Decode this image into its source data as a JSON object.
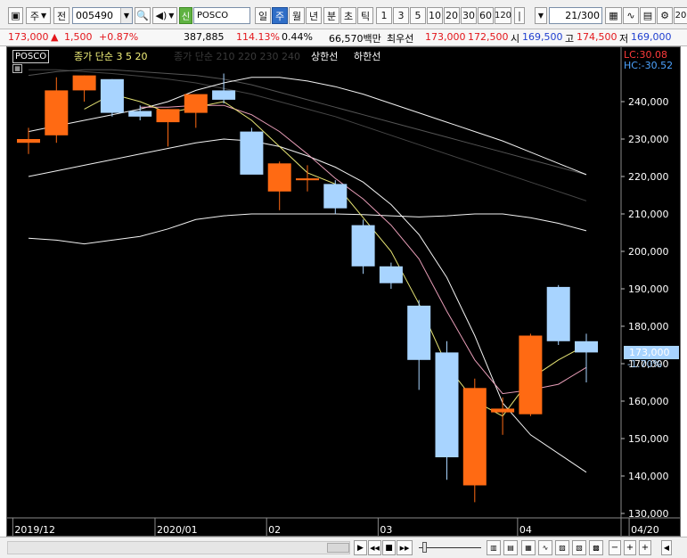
{
  "toolbar": {
    "market_type": "주",
    "market_sub": "전",
    "code": "005490",
    "badge": "신",
    "name": "POSCO",
    "period_day": "일",
    "period_week": "주",
    "period_month": "월",
    "period_year": "년",
    "period_min": "분",
    "period_tick": "초",
    "period_tick2": "틱",
    "intervals": [
      "1",
      "3",
      "5",
      "10",
      "20",
      "30",
      "60",
      "120"
    ],
    "count": "21",
    "total": "/300",
    "edge_label": "20"
  },
  "quote": {
    "price": "173,000",
    "change": "1,500",
    "change_pct": "+0.87%",
    "volume": "387,885",
    "volume_ratio": "114.13%",
    "turnover": "0.44%",
    "amount": "66,570백만",
    "best_ask_label": "최우선",
    "best_ask": "173,000",
    "best_bid": "172,500",
    "open_label": "시",
    "open": "169,500",
    "high_label": "고",
    "high": "174,500",
    "low_label": "저",
    "low": "169,000"
  },
  "legend": {
    "name": "POSCO",
    "close_ma": "종가 단순 3  5  20",
    "ma_long": "종가 단순 210 220 230 240",
    "upper_limit": "상한선",
    "lower_limit": "하한선",
    "lc": "LC:30.08",
    "hc": "HC:-30.52",
    "current_price": "173,000",
    "current_change": "-1.70%"
  },
  "chart_data": {
    "type": "candlestick",
    "ylim": [
      128000,
      250000
    ],
    "yticks": [
      130000,
      140000,
      150000,
      160000,
      170000,
      180000,
      190000,
      200000,
      210000,
      220000,
      230000,
      240000
    ],
    "ytick_labels": [
      "130,000",
      "140,000",
      "150,000",
      "160,000",
      "170,000",
      "180,000",
      "190,000",
      "200,000",
      "210,000",
      "220,000",
      "230,000",
      "240,000"
    ],
    "xlabels": [
      {
        "label": "2019/12",
        "index": -0.5
      },
      {
        "label": "2020/01",
        "index": 4.6
      },
      {
        "label": "02",
        "index": 8.6
      },
      {
        "label": "03",
        "index": 12.6
      },
      {
        "label": "04",
        "index": 17.6
      },
      {
        "label": "04/20",
        "index": 21.6
      }
    ],
    "candles": [
      {
        "o": 229000,
        "h": 233000,
        "l": 226000,
        "c": 230000
      },
      {
        "o": 231000,
        "h": 246500,
        "l": 229000,
        "c": 243000
      },
      {
        "o": 243000,
        "h": 247000,
        "l": 240000,
        "c": 247000
      },
      {
        "o": 246000,
        "h": 246000,
        "l": 236000,
        "c": 237000
      },
      {
        "o": 237500,
        "h": 239000,
        "l": 235000,
        "c": 236000
      },
      {
        "o": 234500,
        "h": 238000,
        "l": 228000,
        "c": 238000
      },
      {
        "o": 237000,
        "h": 240000,
        "l": 233000,
        "c": 242000
      },
      {
        "o": 243000,
        "h": 247500,
        "l": 239500,
        "c": 240500
      },
      {
        "o": 232000,
        "h": 233000,
        "l": 221000,
        "c": 220500
      },
      {
        "o": 216000,
        "h": 224000,
        "l": 211000,
        "c": 223500
      },
      {
        "o": 219000,
        "h": 223000,
        "l": 216000,
        "c": 219500
      },
      {
        "o": 218000,
        "h": 219000,
        "l": 210000,
        "c": 211500
      },
      {
        "o": 207000,
        "h": 208500,
        "l": 194000,
        "c": 196000
      },
      {
        "o": 196000,
        "h": 197000,
        "l": 190000,
        "c": 191500
      },
      {
        "o": 185500,
        "h": 187000,
        "l": 163000,
        "c": 171000
      },
      {
        "o": 173000,
        "h": 176000,
        "l": 139000,
        "c": 145000
      },
      {
        "o": 137500,
        "h": 166000,
        "l": 133000,
        "c": 163500
      },
      {
        "o": 157000,
        "h": 161000,
        "l": 151000,
        "c": 158000
      },
      {
        "o": 156500,
        "h": 178000,
        "l": 156000,
        "c": 177500
      },
      {
        "o": 190500,
        "h": 191000,
        "l": 175000,
        "c": 176000
      },
      {
        "o": 176000,
        "h": 178000,
        "l": 165000,
        "c": 173000
      }
    ],
    "series": [
      {
        "name": "3",
        "color": "#f2f07a",
        "values": [
          null,
          null,
          238000,
          242000,
          240000,
          237000,
          238500,
          240000,
          235000,
          228000,
          221000,
          218000,
          209000,
          200000,
          186000,
          169500,
          160000,
          156000,
          166000,
          171000,
          175000
        ]
      },
      {
        "name": "5",
        "color": "#f2a4c0",
        "values": [
          null,
          null,
          null,
          null,
          238500,
          238500,
          239000,
          239000,
          236500,
          232000,
          226000,
          219500,
          214000,
          207000,
          198000,
          184000,
          171000,
          162000,
          163000,
          164500,
          169000
        ]
      },
      {
        "name": "20",
        "color": "#ffffff",
        "values": [
          220000,
          221500,
          223000,
          224500,
          226000,
          227500,
          229000,
          230000,
          229500,
          228000,
          225500,
          222500,
          218500,
          212500,
          204500,
          193000,
          177500,
          159500,
          151000,
          146000,
          141000
        ]
      },
      {
        "name": "210",
        "color": "#ffffff",
        "values": [
          203500,
          203000,
          202000,
          203000,
          204000,
          206000,
          208500,
          209500,
          210000,
          210000,
          210000,
          210000,
          209800,
          209500,
          209200,
          209500,
          210000,
          210000,
          209000,
          207500,
          205500
        ]
      },
      {
        "name": "220",
        "color": "#ffffff",
        "values": [
          232000,
          233500,
          235000,
          236500,
          238000,
          240000,
          243000,
          245000,
          246500,
          246500,
          245500,
          244000,
          242000,
          239500,
          237000,
          234500,
          232000,
          229500,
          226500,
          223500,
          220500
        ]
      },
      {
        "name": "230",
        "color": "#5a5a5a",
        "values": [
          247000,
          248000,
          248500,
          248500,
          248000,
          247500,
          247000,
          246000,
          244500,
          242500,
          240500,
          238500,
          236500,
          234500,
          232500,
          230500,
          228500,
          226500,
          224500,
          222500,
          220500
        ]
      },
      {
        "name": "240",
        "color": "#4a4a4a",
        "values": [
          248500,
          248500,
          248000,
          247500,
          246800,
          246000,
          245000,
          243500,
          242000,
          240000,
          238000,
          236000,
          233500,
          231000,
          228500,
          226000,
          223500,
          221000,
          218500,
          216000,
          213500
        ]
      }
    ],
    "up_color": "#ff6a13",
    "down_color": "#a8d4ff"
  },
  "bottom": {
    "nav_first": "▶",
    "nav_fast": "◀◀",
    "nav_stop": "■",
    "nav_next": "▶▶",
    "zoom_minus": "−",
    "zoom_plus": "+",
    "collapse": "◀"
  }
}
